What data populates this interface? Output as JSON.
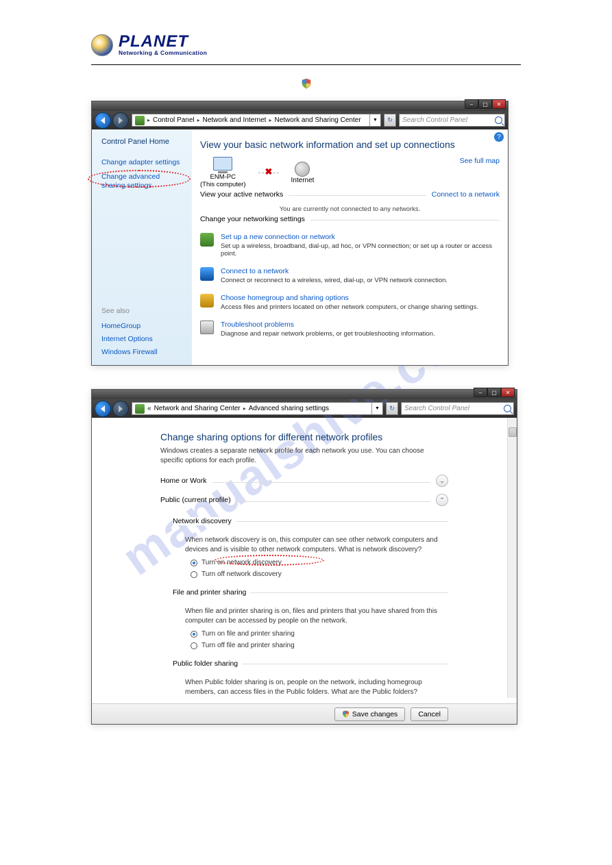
{
  "brand": {
    "name": "PLANET",
    "tagline": "Networking & Communication"
  },
  "watermark": "manualshive.com",
  "window1": {
    "titlebar_buttons": {
      "min": "–",
      "max": "▢",
      "close": "✕"
    },
    "breadcrumb": [
      "Control Panel",
      "Network and Internet",
      "Network and Sharing Center"
    ],
    "search_placeholder": "Search Control Panel",
    "sidebar": {
      "home": "Control Panel Home",
      "links": [
        "Change adapter settings",
        "Change advanced sharing settings"
      ],
      "see_also_heading": "See also",
      "see_also": [
        "HomeGroup",
        "Internet Options",
        "Windows Firewall"
      ]
    },
    "main": {
      "heading": "View your basic network information and set up connections",
      "full_map": "See full map",
      "pc_name": "ENM-PC",
      "pc_sub": "(This computer)",
      "internet": "Internet",
      "active_header": "View your active networks",
      "connect_link": "Connect to a network",
      "not_connected": "You are currently not connected to any networks.",
      "change_header": "Change your networking settings",
      "options": [
        {
          "title": "Set up a new connection or network",
          "desc": "Set up a wireless, broadband, dial-up, ad hoc, or VPN connection; or set up a router or access point."
        },
        {
          "title": "Connect to a network",
          "desc": "Connect or reconnect to a wireless, wired, dial-up, or VPN network connection."
        },
        {
          "title": "Choose homegroup and sharing options",
          "desc": "Access files and printers located on other network computers, or change sharing settings."
        },
        {
          "title": "Troubleshoot problems",
          "desc": "Diagnose and repair network problems, or get troubleshooting information."
        }
      ]
    }
  },
  "window2": {
    "breadcrumb_prefix": "«",
    "breadcrumb": [
      "Network and Sharing Center",
      "Advanced sharing settings"
    ],
    "search_placeholder": "Search Control Panel",
    "main": {
      "heading": "Change sharing options for different network profiles",
      "sub": "Windows creates a separate network profile for each network you use. You can choose specific options for each profile.",
      "profile_home": "Home or Work",
      "profile_public": "Public (current profile)",
      "net_disc": {
        "title": "Network discovery",
        "desc_prefix": "When network discovery is on, this computer can see other network computers and devices and is visible to other network computers. ",
        "link": "What is network discovery?",
        "opt_on": "Turn on network discovery",
        "opt_off": "Turn off network discovery"
      },
      "file_share": {
        "title": "File and printer sharing",
        "desc": "When file and printer sharing is on, files and printers that you have shared from this computer can be accessed by people on the network.",
        "opt_on": "Turn on file and printer sharing",
        "opt_off": "Turn off file and printer sharing"
      },
      "public_folder": {
        "title": "Public folder sharing",
        "desc_prefix": "When Public folder sharing is on, people on the network, including homegroup members, can access files in the Public folders. ",
        "link": "What are the Public folders?"
      }
    },
    "buttons": {
      "save": "Save changes",
      "cancel": "Cancel"
    }
  }
}
